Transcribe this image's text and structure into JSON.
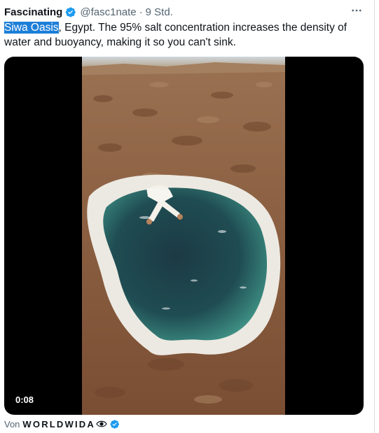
{
  "tweet": {
    "author_name": "Fascinating",
    "author_handle": "@fasc1nate",
    "separator": "·",
    "timestamp": "9 Std.",
    "more_icon": "more-horizontal-icon",
    "text_highlight": "Siwa Oasis",
    "text_rest": ", Egypt. The 95% salt concentration increases the density of water and buoyancy, making it so you can't sink.",
    "video_duration": "0:08",
    "attribution_prefix": "Von",
    "attribution_source": "WORLDWIDA",
    "attribution_icon": "eye-icon"
  },
  "colors": {
    "verified_blue": "#1d9bf0",
    "text_primary": "#0f1419",
    "text_secondary": "#536471",
    "highlight": "#1d7ed8"
  }
}
